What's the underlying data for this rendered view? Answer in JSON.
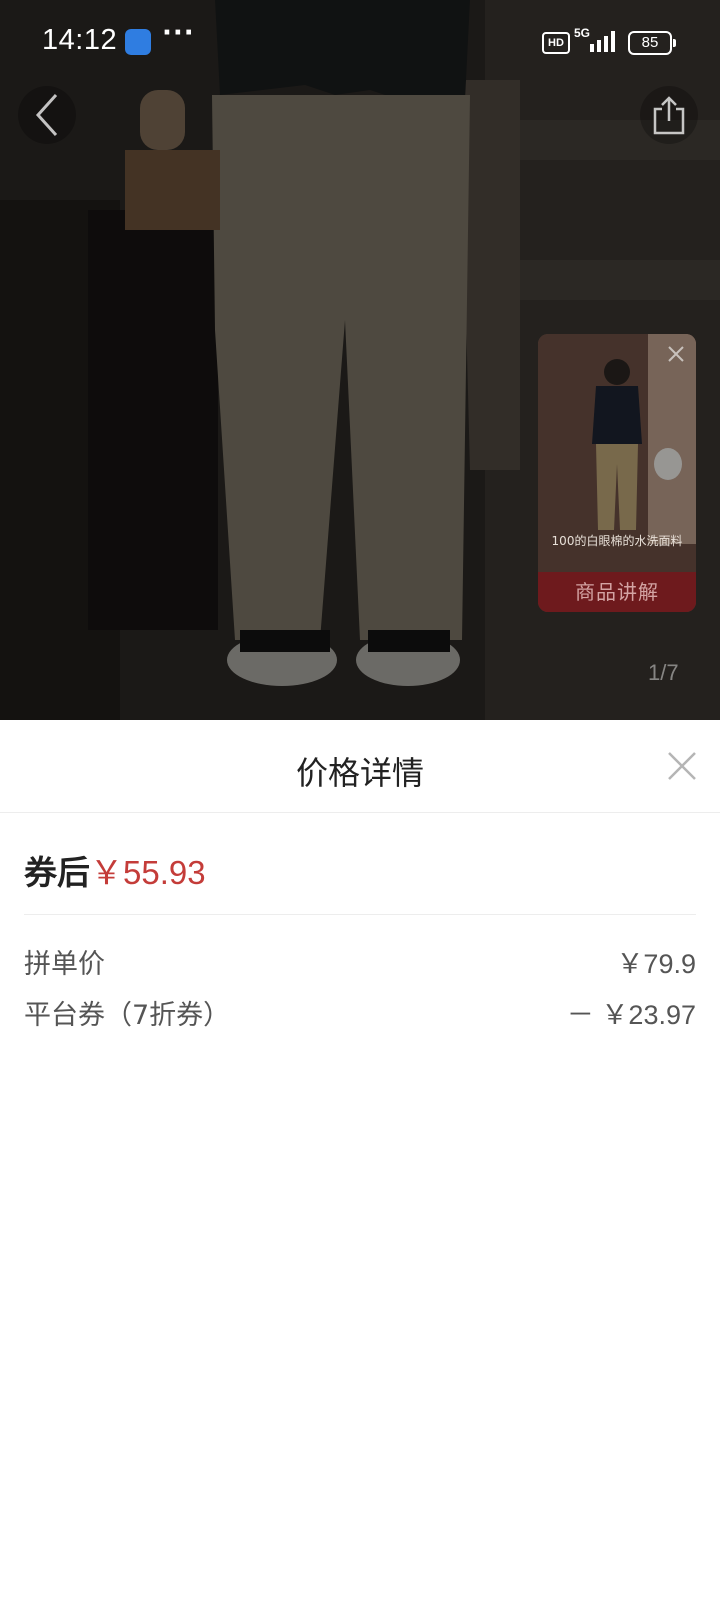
{
  "status_bar": {
    "time": "14:12",
    "dots": "···",
    "hd": "HD",
    "network": "5G",
    "battery": "85"
  },
  "product": {
    "page_indicator": "1/7",
    "video_card": {
      "caption": "100的白眼棉的水洗面料",
      "label": "商品讲解"
    }
  },
  "price_sheet": {
    "title": "价格详情",
    "final_label": "券后",
    "final_price": "￥55.93",
    "items": [
      {
        "label": "拼单价",
        "value": "￥79.9"
      },
      {
        "label": "平台券（7折券）",
        "value": "－ ￥23.97"
      }
    ]
  },
  "colors": {
    "accent_red": "#c43c39",
    "text_primary": "#222222",
    "text_secondary": "#555555"
  },
  "icons": [
    "back-arrow-icon",
    "share-icon",
    "close-icon",
    "video-close-icon",
    "signal-icon",
    "battery-icon"
  ]
}
